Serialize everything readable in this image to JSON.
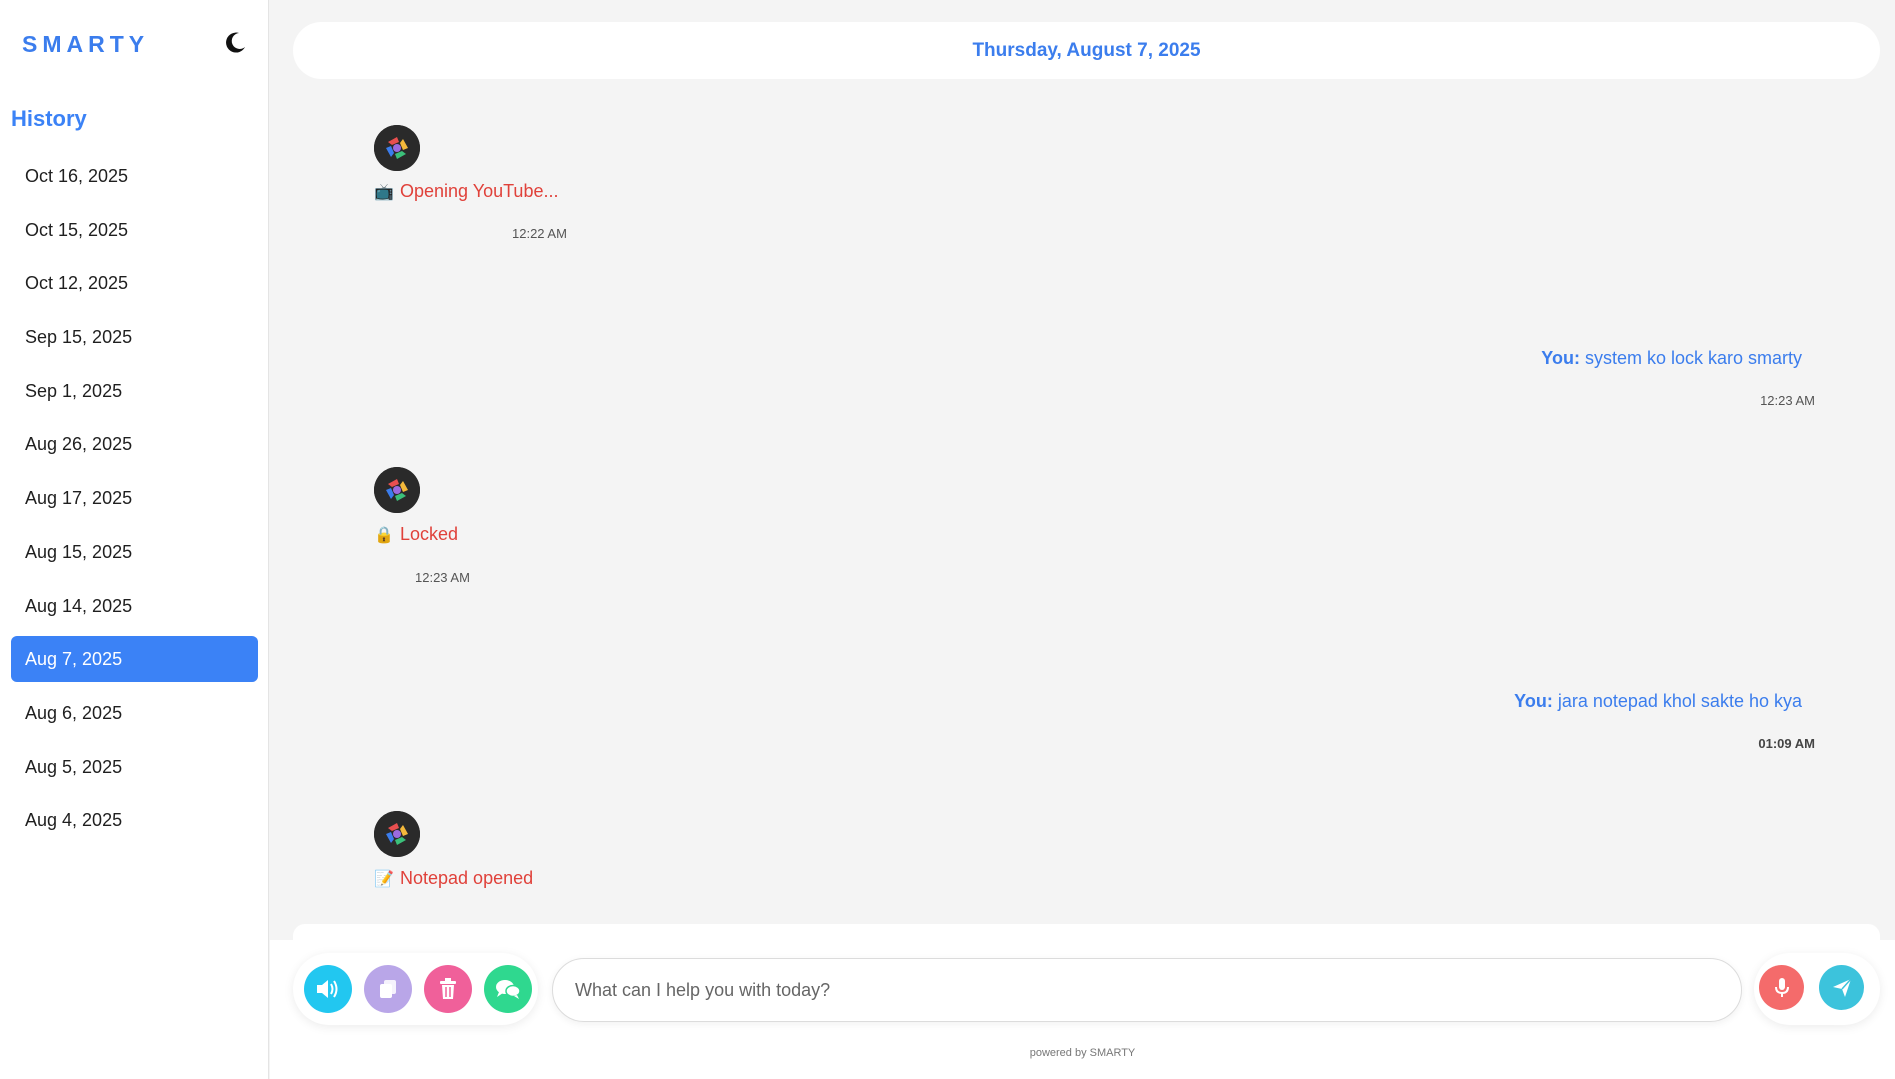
{
  "sidebar": {
    "brand": "SMARTY",
    "history_title": "History",
    "items": [
      {
        "label": "Oct 16, 2025",
        "active": false
      },
      {
        "label": "Oct 15, 2025",
        "active": false
      },
      {
        "label": "Oct 12, 2025",
        "active": false
      },
      {
        "label": "Sep 15, 2025",
        "active": false
      },
      {
        "label": "Sep 1, 2025",
        "active": false
      },
      {
        "label": "Aug 26, 2025",
        "active": false
      },
      {
        "label": "Aug 17, 2025",
        "active": false
      },
      {
        "label": "Aug 15, 2025",
        "active": false
      },
      {
        "label": "Aug 14, 2025",
        "active": false
      },
      {
        "label": "Aug 7, 2025",
        "active": true
      },
      {
        "label": "Aug 6, 2025",
        "active": false
      },
      {
        "label": "Aug 5, 2025",
        "active": false
      },
      {
        "label": "Aug 4, 2025",
        "active": false
      }
    ],
    "theme_icon": "moon-icon"
  },
  "chat": {
    "date_header": "Thursday, August 7, 2025",
    "messages": [
      {
        "role": "bot",
        "icon": "tv-icon",
        "text": "Opening YouTube...",
        "time": "12:22 AM"
      },
      {
        "role": "user",
        "prefix": "You:",
        "text": "system ko lock karo smarty",
        "time": "12:23 AM"
      },
      {
        "role": "bot",
        "icon": "lock-icon",
        "text": "Locked",
        "time": "12:23 AM"
      },
      {
        "role": "user",
        "prefix": "You:",
        "text": "jara notepad khol sakte ho kya",
        "time": "01:09 AM"
      },
      {
        "role": "bot",
        "icon": "memo-icon",
        "text": "Notepad opened",
        "time": ""
      }
    ]
  },
  "input": {
    "placeholder": "What can I help you with today?",
    "value": ""
  },
  "toolbar": {
    "buttons": [
      {
        "name": "speaker-button",
        "icon": "speaker-icon",
        "color": "#22c7f0"
      },
      {
        "name": "copy-button",
        "icon": "copy-icon",
        "color": "#b9a6e8"
      },
      {
        "name": "delete-button",
        "icon": "trash-icon",
        "color": "#f0609a"
      },
      {
        "name": "chat-button",
        "icon": "chat-bubbles-icon",
        "color": "#2fd88f"
      }
    ],
    "mic_color": "#f46b6b",
    "send_color": "#3cc3dc"
  },
  "footer": "powered by SMARTY",
  "colors": {
    "accent": "#3b82f6",
    "bot_text": "#e0413a",
    "active_item": "#3b82f6"
  }
}
